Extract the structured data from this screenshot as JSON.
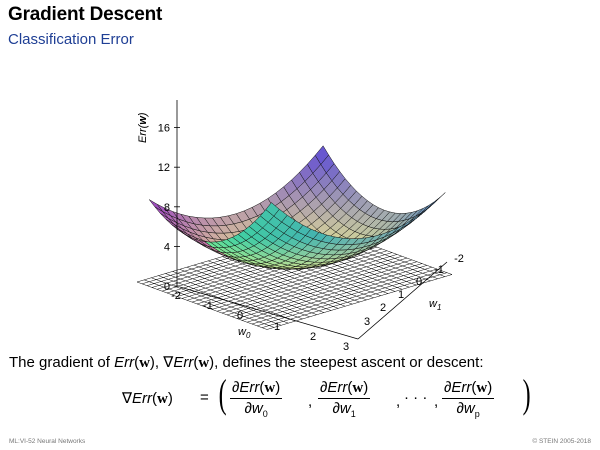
{
  "header": {
    "title": "Gradient Descent",
    "subtitle": "Classification Error"
  },
  "plot": {
    "z_axis_label_prefix": "Err(",
    "z_axis_label_var": "w",
    "z_axis_label_suffix": ")",
    "z_ticks": [
      "16",
      "12",
      "8",
      "4",
      "0"
    ],
    "w0_ticks": [
      "-2",
      "-1",
      "0",
      "1",
      "2",
      "3"
    ],
    "w1_ticks": [
      "-2",
      "-1",
      "0",
      "1",
      "2",
      "3"
    ],
    "w0_label_base": "w",
    "w0_label_sub": "0",
    "w1_label_base": "w",
    "w1_label_sub": "1",
    "colors": {
      "floor_grid": "#000000",
      "surface_low": "#f5f08a",
      "surface_left": "#b44ab6",
      "surface_back": "#4f5bd8",
      "surface_right": "#3ee39a"
    }
  },
  "text": {
    "lead_1": "The gradient of ",
    "err_it": "Err",
    "w_bold": "w",
    "lead_2": "), ",
    "nabla": "∇",
    "lead_3": "), defines the steepest ascent or descent:",
    "partial": "∂",
    "w0": "w",
    "sub0": "0",
    "sub1": "1",
    "subp": "p",
    "ellipsis": "· · ·",
    "eq": "="
  },
  "footer": {
    "left": "ML:VI-52    Neural Networks",
    "right": "© STEIN 2005-2018"
  }
}
